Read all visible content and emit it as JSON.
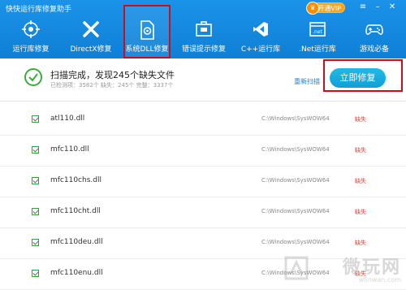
{
  "window": {
    "title": "快快运行库修复助手",
    "vip_label": "开通VIP",
    "vip_icon": "crown-icon"
  },
  "nav": {
    "items": [
      {
        "label": "运行库修复",
        "icon": "runtime-target-icon"
      },
      {
        "label": "DirectX修复",
        "icon": "directx-icon"
      },
      {
        "label": "系统DLL修复",
        "icon": "dll-file-icon",
        "active": true
      },
      {
        "label": "错误提示修复",
        "icon": "error-box-icon"
      },
      {
        "label": "C++运行库",
        "icon": "visual-studio-icon"
      },
      {
        "label": ".Net运行库",
        "icon": "dotnet-icon"
      },
      {
        "label": "游戏必备",
        "icon": "gamepad-icon"
      }
    ]
  },
  "status": {
    "title": "扫描完成，发现245个缺失文件",
    "stats": "已检测项：3582个   缺失：245个   完整：3337个",
    "rescan": "重新扫描",
    "fix_button": "立即修复"
  },
  "files": [
    {
      "name": "atl110.dll",
      "path": "C:\\Windows\\SysWOW64",
      "status": "缺失"
    },
    {
      "name": "mfc110.dll",
      "path": "C:\\Windows\\SysWOW64",
      "status": "缺失"
    },
    {
      "name": "mfc110chs.dll",
      "path": "C:\\Windows\\SysWOW64",
      "status": "缺失"
    },
    {
      "name": "mfc110cht.dll",
      "path": "C:\\Windows\\SysWOW64",
      "status": "缺失"
    },
    {
      "name": "mfc110deu.dll",
      "path": "C:\\Windows\\SysWOW64",
      "status": "缺失"
    },
    {
      "name": "mfc110enu.dll",
      "path": "C:\\Windows\\SysWOW64",
      "status": "缺失"
    }
  ],
  "watermark": {
    "big": "微玩网",
    "small": "wlinwan.com"
  },
  "colors": {
    "header": "#1a8ae3",
    "accent": "#1aa8e0",
    "missing": "#e03c28",
    "highlight": "#c8101c"
  }
}
